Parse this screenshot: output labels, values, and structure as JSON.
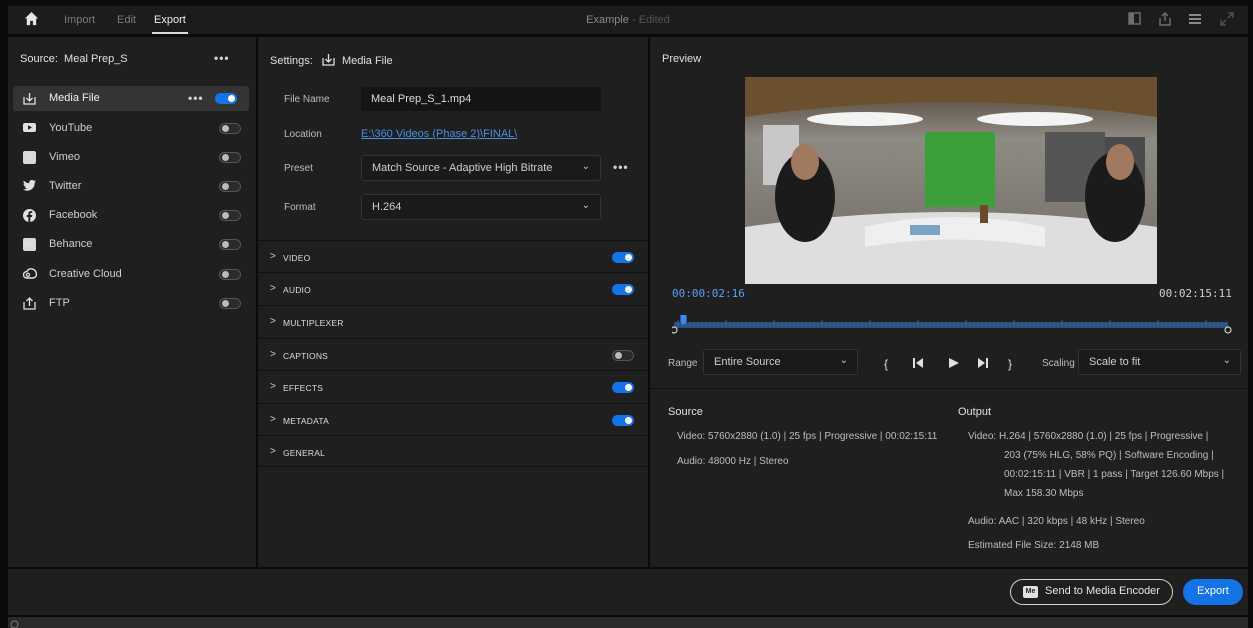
{
  "topbar": {
    "tabs": [
      "Import",
      "Edit",
      "Export"
    ],
    "active_tab": "Export",
    "title": "Example",
    "title_suffix": "- Edited",
    "icons": [
      "home-icon",
      "layout-icon",
      "share-icon",
      "menu-icon",
      "fullscreen-icon"
    ]
  },
  "source": {
    "label": "Source:",
    "name": "Meal Prep_S",
    "destinations": [
      {
        "label": "Media File",
        "icon": "media-file-icon",
        "enabled": true
      },
      {
        "label": "YouTube",
        "icon": "youtube-icon",
        "enabled": false
      },
      {
        "label": "Vimeo",
        "icon": "vimeo-icon",
        "enabled": false
      },
      {
        "label": "Twitter",
        "icon": "twitter-icon",
        "enabled": false
      },
      {
        "label": "Facebook",
        "icon": "facebook-icon",
        "enabled": false
      },
      {
        "label": "Behance",
        "icon": "behance-icon",
        "enabled": false
      },
      {
        "label": "Creative Cloud",
        "icon": "creative-cloud-icon",
        "enabled": false
      },
      {
        "label": "FTP",
        "icon": "ftp-icon",
        "enabled": false
      }
    ]
  },
  "settings": {
    "label": "Settings:",
    "target": "Media File",
    "file_name_label": "File Name",
    "file_name": "Meal Prep_S_1.mp4",
    "location_label": "Location",
    "location": "E:\\360 Videos (Phase 2)\\FINAL\\",
    "preset_label": "Preset",
    "preset": "Match Source - Adaptive High Bitrate",
    "format_label": "Format",
    "format": "H.264",
    "sections": [
      {
        "name": "VIDEO",
        "toggle": "on"
      },
      {
        "name": "AUDIO",
        "toggle": "on"
      },
      {
        "name": "MULTIPLEXER",
        "toggle": "none"
      },
      {
        "name": "CAPTIONS",
        "toggle": "off"
      },
      {
        "name": "EFFECTS",
        "toggle": "on"
      },
      {
        "name": "METADATA",
        "toggle": "on"
      },
      {
        "name": "GENERAL",
        "toggle": "none"
      }
    ]
  },
  "preview": {
    "title": "Preview",
    "current_time": "00:00:02:16",
    "duration": "00:02:15:11",
    "playhead_fraction": 0.01,
    "range_label": "Range",
    "range_value": "Entire Source",
    "scaling_label": "Scaling",
    "scaling_value": "Scale to fit"
  },
  "source_info": {
    "heading": "Source",
    "video": "Video:  5760x2880 (1.0) | 25 fps | Progressive | 00:02:15:11",
    "audio": "Audio:  48000 Hz | Stereo"
  },
  "output_info": {
    "heading": "Output",
    "video_lines": [
      "Video:  H.264 | 5760x2880 (1.0) | 25 fps | Progressive |",
      "203 (75% HLG, 58% PQ) | Software Encoding |",
      "00:02:15:11  | VBR | 1 pass | Target 126.60 Mbps |",
      "Max 158.30 Mbps"
    ],
    "audio": "Audio:  AAC | 320 kbps | 48 kHz | Stereo",
    "file_size": "Estimated File Size:  2148 MB"
  },
  "footer": {
    "media_encoder_badge": "Me",
    "send_label": "Send to Media Encoder",
    "export_label": "Export"
  },
  "colors": {
    "accent": "#1473e6",
    "link": "#4a90e2",
    "panel": "#1f1f1f"
  }
}
